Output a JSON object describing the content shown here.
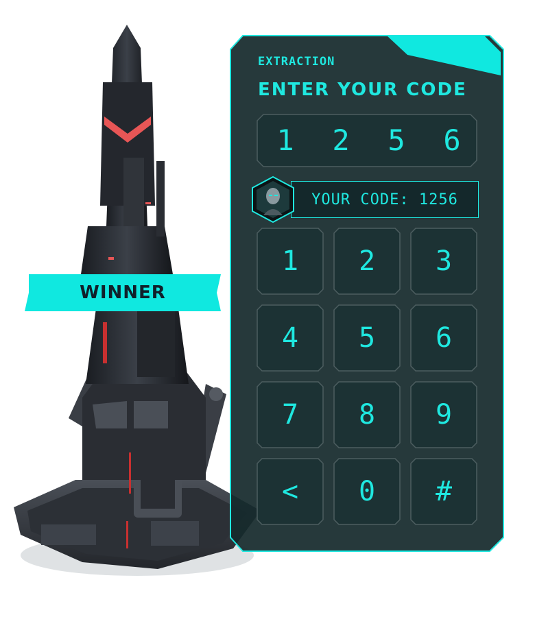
{
  "badge": {
    "label": "WINNER"
  },
  "panel": {
    "eyebrow": "EXTRACTION",
    "title": "ENTER YOUR CODE",
    "entered_digits": [
      "1",
      "2",
      "5",
      "6"
    ],
    "code_line": "YOUR CODE: 1256"
  },
  "keypad": {
    "keys": [
      "1",
      "2",
      "3",
      "4",
      "5",
      "6",
      "7",
      "8",
      "9",
      "<",
      "0",
      "#"
    ]
  },
  "colors": {
    "accent": "#1fe8e0",
    "panel_bg": "#152a2c",
    "key_border": "#4d5e60"
  }
}
